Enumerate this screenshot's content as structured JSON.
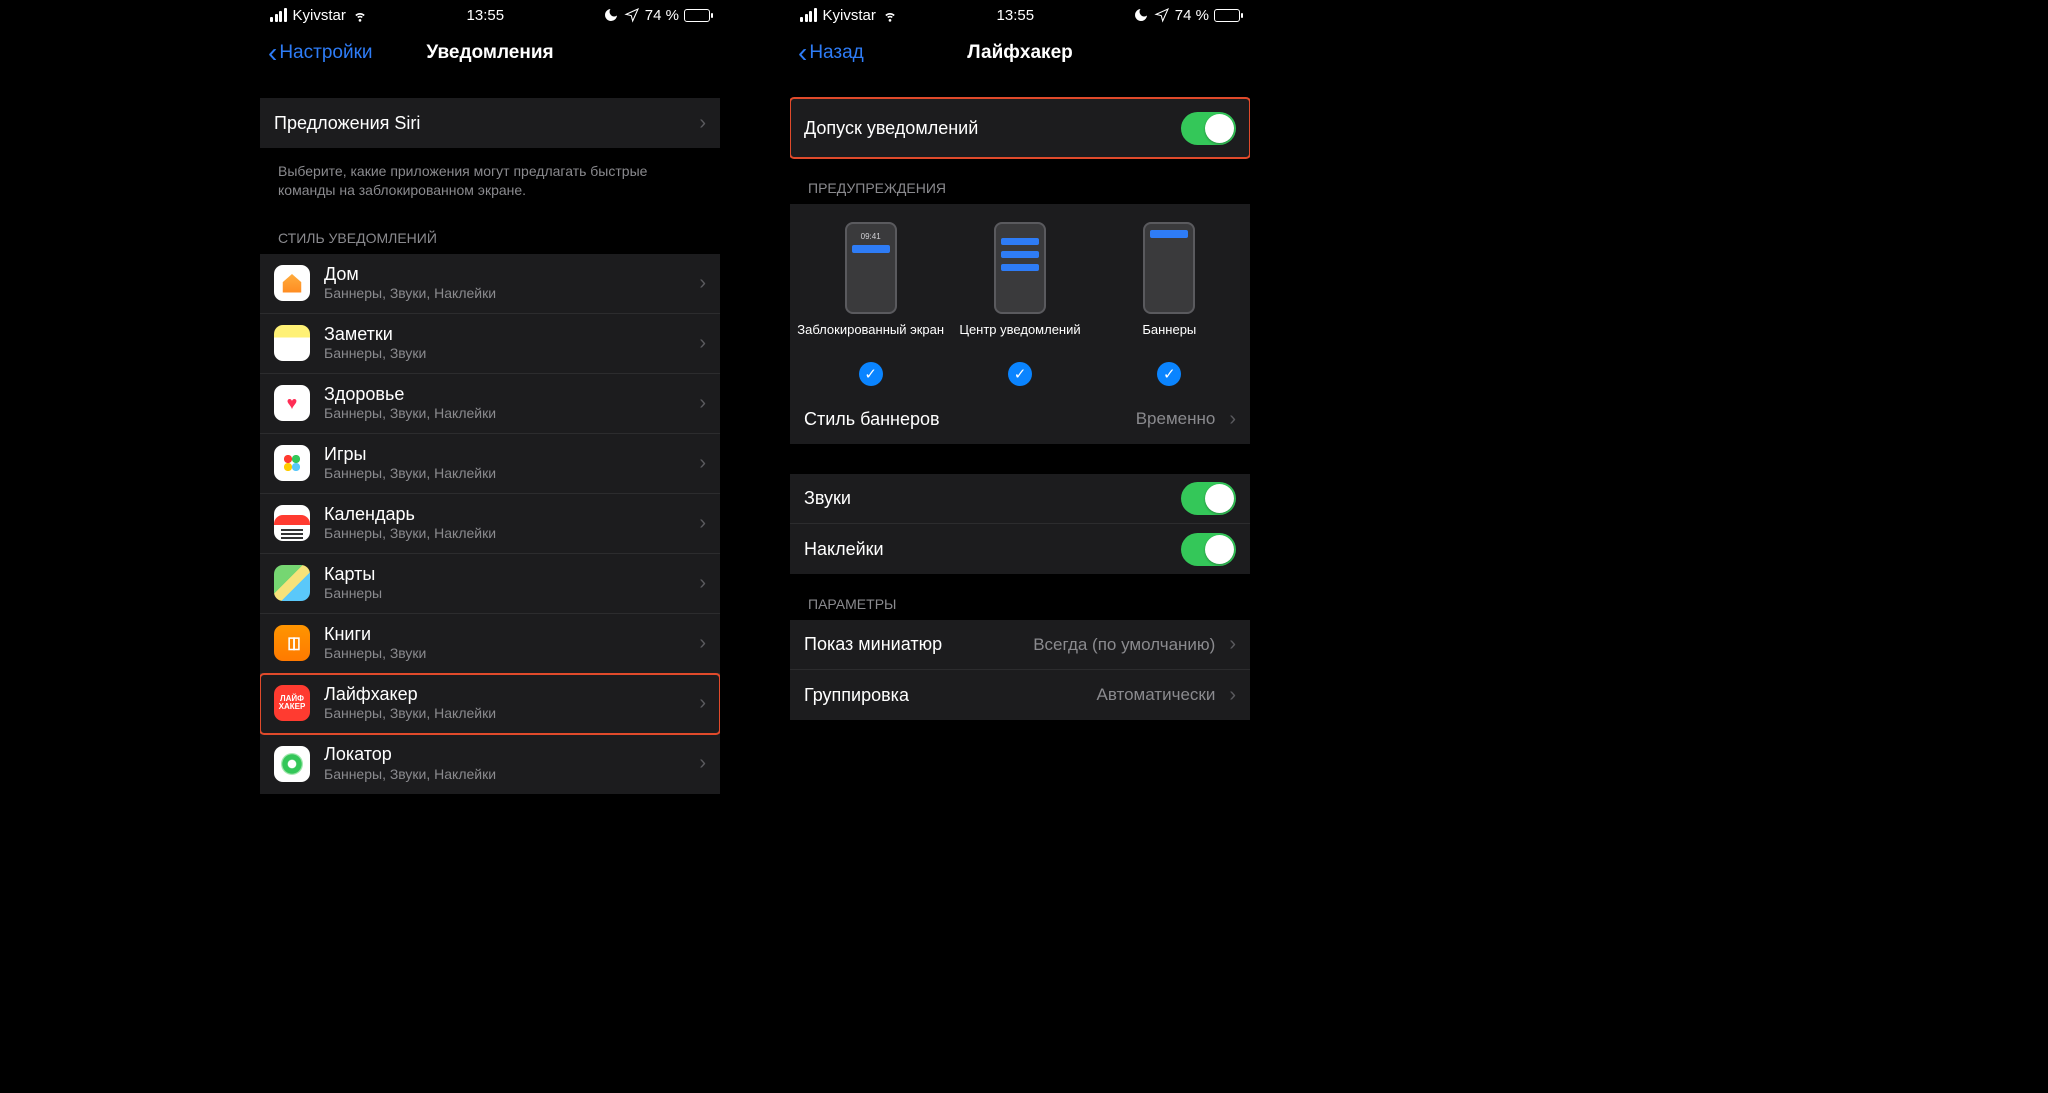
{
  "status": {
    "carrier": "Kyivstar",
    "time": "13:55",
    "battery_pct": "74 %"
  },
  "screen1": {
    "back": "Настройки",
    "title": "Уведомления",
    "siri_row": "Предложения Siri",
    "siri_desc": "Выберите, какие приложения могут предлагать быстрые команды на заблокированном экране.",
    "style_header": "СТИЛЬ УВЕДОМЛЕНИЙ",
    "apps": [
      {
        "name": "Дом",
        "sub": "Баннеры, Звуки, Наклейки"
      },
      {
        "name": "Заметки",
        "sub": "Баннеры, Звуки"
      },
      {
        "name": "Здоровье",
        "sub": "Баннеры, Звуки, Наклейки"
      },
      {
        "name": "Игры",
        "sub": "Баннеры, Звуки, Наклейки"
      },
      {
        "name": "Календарь",
        "sub": "Баннеры, Звуки, Наклейки"
      },
      {
        "name": "Карты",
        "sub": "Баннеры"
      },
      {
        "name": "Книги",
        "sub": "Баннеры, Звуки"
      },
      {
        "name": "Лайфхакер",
        "sub": "Баннеры, Звуки, Наклейки"
      },
      {
        "name": "Локатор",
        "sub": "Баннеры, Звуки, Наклейки"
      }
    ]
  },
  "screen2": {
    "back": "Назад",
    "title": "Лайфхакер",
    "allow": "Допуск уведомлений",
    "alerts_header": "ПРЕДУПРЕЖДЕНИЯ",
    "alerts": {
      "lock": "Заблокированный экран",
      "center": "Центр уведомлений",
      "banner": "Баннеры",
      "preview_time": "09:41"
    },
    "banner_style": {
      "label": "Стиль баннеров",
      "value": "Временно"
    },
    "sounds": "Звуки",
    "badges": "Наклейки",
    "params_header": "ПАРАМЕТРЫ",
    "previews": {
      "label": "Показ миниатюр",
      "value": "Всегда (по умолчанию)"
    },
    "grouping": {
      "label": "Группировка",
      "value": "Автоматически"
    }
  },
  "lifehacker_icon_text": "ЛАЙФ\nХАКЕР"
}
